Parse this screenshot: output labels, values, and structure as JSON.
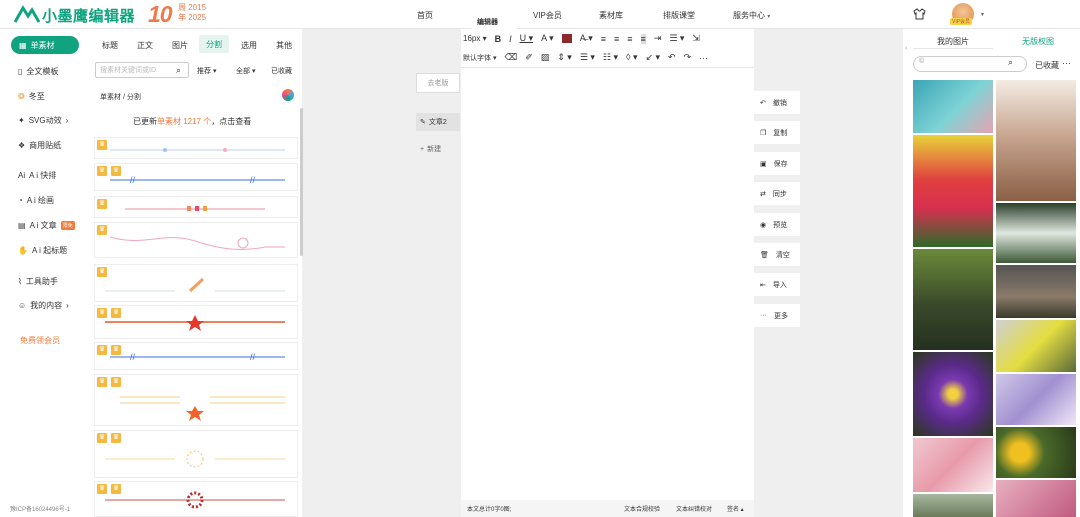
{
  "header": {
    "logo_text": "小墨鹰编辑器",
    "anniv_num": "10",
    "anniv_line1": "周 2015",
    "anniv_line2": "年 2025",
    "nav": [
      "首页",
      "编辑器",
      "VIP会员",
      "素材库",
      "排版课堂",
      "服务中心"
    ],
    "vip_badge": "VIP会员"
  },
  "sidebar": {
    "active": "单素材",
    "items": [
      "全文模板",
      "冬至",
      "SVG动效",
      "商用贴纸",
      "A i 快排",
      "A i 绘画",
      "A i 文章",
      "A i 起标题",
      "工具助手",
      "我的内容"
    ],
    "new_badge": "限免",
    "free_vip": "免费领会员",
    "icp": "豫ICP备16024496号-1"
  },
  "materials": {
    "tabs": [
      "标题",
      "正文",
      "图片",
      "分割",
      "选用",
      "其他"
    ],
    "active_tab": "分割",
    "search_placeholder": "搜素材关键词或ID",
    "filter1": "推荐",
    "filter2": "全部",
    "favorites": "已收藏",
    "breadcrumb": "单素材 / 分割",
    "updated_pre": "已更新",
    "updated_hl": "单素材 1217 个",
    "updated_post": "，点击查看"
  },
  "middle": {
    "old_version": "去老版",
    "article": "文章2",
    "new": "新建"
  },
  "toolbar": {
    "font_size": "16px",
    "font": "默认字体"
  },
  "editor_status": {
    "count": "本文总计0字0图;",
    "check1": "文本合规校验",
    "check2": "文本纠错校对",
    "sign": "签名"
  },
  "actions": [
    "撤销",
    "复制",
    "保存",
    "同步",
    "预览",
    "清空",
    "导入",
    "更多"
  ],
  "right": {
    "tab1": "我的图片",
    "tab2": "无版权图",
    "favorites": "已收藏"
  },
  "colors": {
    "brand": "#0fa37f",
    "accent": "#f5793b"
  }
}
